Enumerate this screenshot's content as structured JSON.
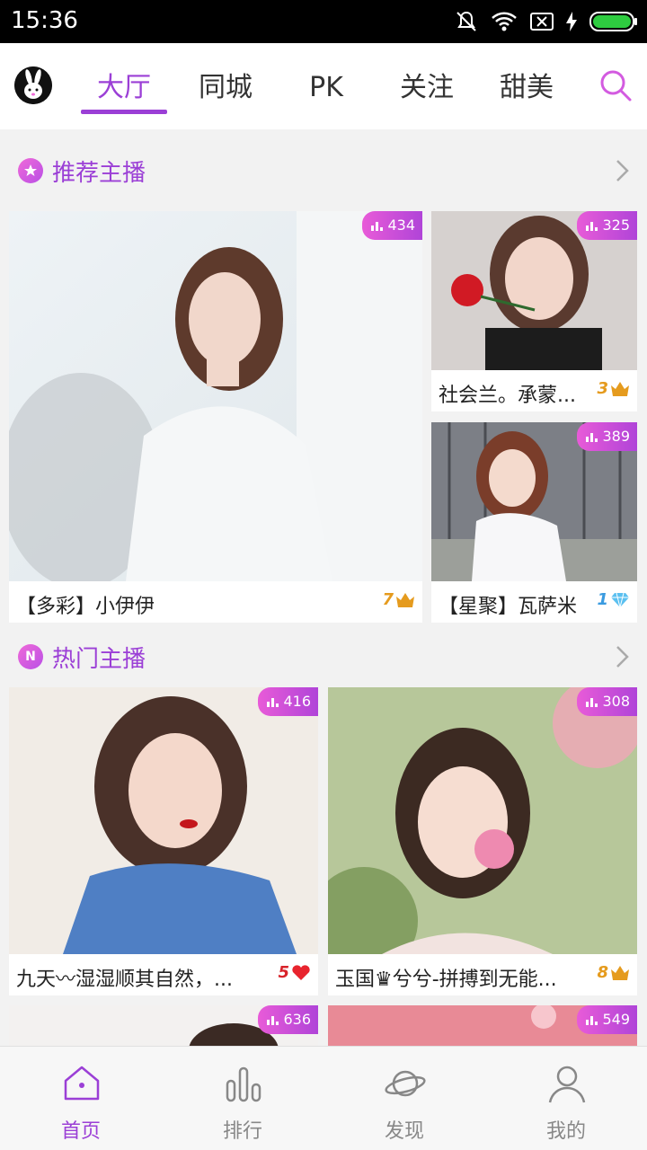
{
  "status_bar": {
    "time": "15:36"
  },
  "top_nav": {
    "tabs": [
      {
        "label": "大厅"
      },
      {
        "label": "同城"
      },
      {
        "label": "PK"
      },
      {
        "label": "关注"
      },
      {
        "label": "甜美"
      }
    ],
    "active_tab": "大厅"
  },
  "sections": [
    {
      "title": "推荐主播",
      "badge_icon": "star-icon",
      "cards": [
        {
          "name": "【多彩】小伊伊",
          "level": "7",
          "level_icon": "crown-icon",
          "viewers": "434"
        },
        {
          "name": "社会兰。承蒙...",
          "level": "3",
          "level_icon": "crown-icon",
          "viewers": "325"
        },
        {
          "name": "【星聚】瓦萨米",
          "level": "1",
          "level_icon": "diamond-icon",
          "viewers": "389"
        }
      ]
    },
    {
      "title": "热门主播",
      "badge_icon": "n-icon",
      "badge_text": "N",
      "cards": [
        {
          "name": "九天〰湿湿顺其自然，...",
          "level": "5",
          "level_icon": "heart-icon",
          "viewers": "416"
        },
        {
          "name": "玉国♛兮兮-拼搏到无能...",
          "level": "8",
          "level_icon": "crown-icon",
          "viewers": "308"
        },
        {
          "viewers": "636"
        },
        {
          "viewers": "549"
        }
      ]
    }
  ],
  "bottom_nav": {
    "items": [
      {
        "label": "首页",
        "icon": "home-icon"
      },
      {
        "label": "排行",
        "icon": "ranking-icon"
      },
      {
        "label": "发现",
        "icon": "planet-icon"
      },
      {
        "label": "我的",
        "icon": "profile-icon"
      }
    ],
    "active": "首页"
  },
  "colors": {
    "accent": "#9b3fd6",
    "badge_gradient_start": "#e85bd8",
    "badge_gradient_end": "#b044d8",
    "level_gold": "#e59b1e"
  }
}
